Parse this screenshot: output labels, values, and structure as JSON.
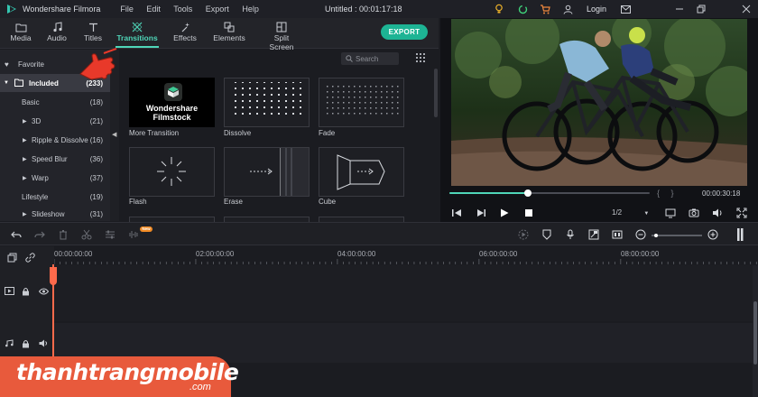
{
  "titlebar": {
    "app_name": "Wondershare Filmora",
    "menu": [
      "File",
      "Edit",
      "Tools",
      "Export",
      "Help"
    ],
    "document": "Untitled : 00:01:17:18",
    "login": "Login"
  },
  "media_tabs": [
    {
      "label": "Media",
      "icon": "folder-icon"
    },
    {
      "label": "Audio",
      "icon": "music-note-icon"
    },
    {
      "label": "Titles",
      "icon": "text-t-icon"
    },
    {
      "label": "Transitions",
      "icon": "transition-icon",
      "active": true
    },
    {
      "label": "Effects",
      "icon": "sparkle-icon"
    },
    {
      "label": "Elements",
      "icon": "elements-icon"
    },
    {
      "label": "Split Screen",
      "icon": "split-screen-icon"
    }
  ],
  "export_label": "EXPORT",
  "categories": {
    "favorite": "Favorite",
    "included_label": "Included",
    "included_count": "(233)",
    "items": [
      {
        "label": "Basic",
        "count": "(18)",
        "expandable": false
      },
      {
        "label": "3D",
        "count": "(21)",
        "expandable": true
      },
      {
        "label": "Ripple & Dissolve",
        "count": "(16)",
        "expandable": true
      },
      {
        "label": "Speed Blur",
        "count": "(36)",
        "expandable": true
      },
      {
        "label": "Warp",
        "count": "(37)",
        "expandable": true
      },
      {
        "label": "Lifestyle",
        "count": "(19)",
        "expandable": false
      },
      {
        "label": "Slideshow",
        "count": "(31)",
        "expandable": true
      }
    ]
  },
  "search": {
    "placeholder": "Search"
  },
  "transitions": [
    {
      "label": "More Transition",
      "thumb_title": "Wondershare\nFilmstock"
    },
    {
      "label": "Dissolve"
    },
    {
      "label": "Fade"
    },
    {
      "label": "Flash"
    },
    {
      "label": "Erase"
    },
    {
      "label": "Cube"
    }
  ],
  "preview": {
    "timecode": "00:00:30:18",
    "ratio": "1/2",
    "progress": 0.39
  },
  "ruler": [
    "00:00:00:00",
    "02:00:00:00",
    "04:00:00:00",
    "06:00:00:00",
    "08:00:00:00"
  ],
  "new_badge": "New",
  "watermark": {
    "brand": "thanhtrangmobile",
    "dotcom": ".com"
  },
  "colors": {
    "accent": "#4fd6b8",
    "export": "#1db494",
    "playhead": "#ff6a4b",
    "banner": "#e85a3c"
  }
}
